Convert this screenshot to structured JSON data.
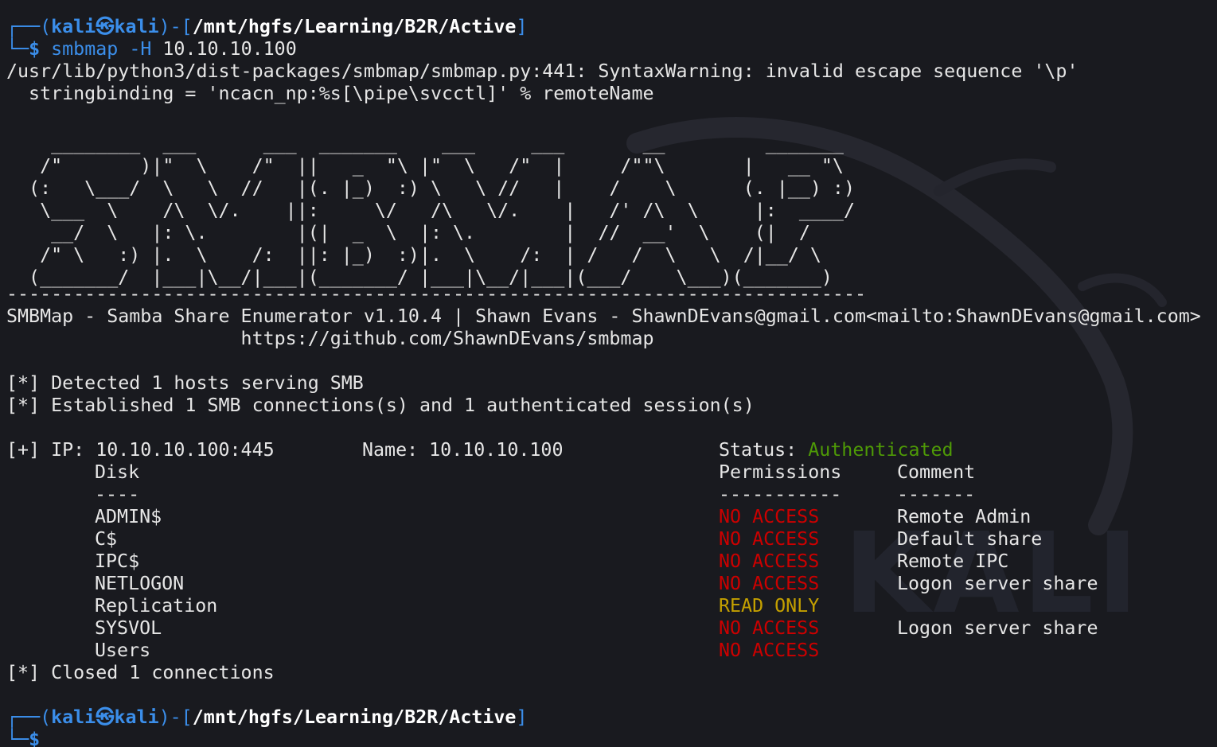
{
  "prompt": {
    "user": "kali",
    "host": "kali",
    "at_symbol": "㉿",
    "path": "/mnt/hgfs/Learning/B2R/Active",
    "dollar": "$"
  },
  "command": {
    "program": "smbmap",
    "flag": "-H",
    "target": "10.10.10.100"
  },
  "warning": {
    "line1": "/usr/lib/python3/dist-packages/smbmap/smbmap.py:441: SyntaxWarning: invalid escape sequence '\\p'",
    "line2": "  stringbinding = 'ncacn_np:%s[\\pipe\\svcctl]' % remoteName"
  },
  "banner": {
    "ascii": "    ________  ___      ___  _______    ___     ___       __         _______\n   /\"       )|\"  \\    /\"  ||   _  \"\\ |\"  \\   /\"  |     /\"\"\\       |   __ \"\\\n  (:   \\___/  \\   \\  //   |(. |_)  :) \\   \\ //   |    /    \\      (. |__) :)\n   \\___  \\    /\\  \\/.    ||:     \\/   /\\   \\/.    |   /' /\\  \\     |:  ____/\n    __/  \\   |: \\.        |(|  _  \\  |: \\.        |  //  __'  \\    (|  /\n   /\" \\   :) |.  \\    /:  ||: |_)  :)|.  \\    /:  | /   /  \\   \\  /|__/ \\\n  (_______/  |___|\\__/|___|(_______/ |___|\\__/|___|(___/    \\___)(_______)",
    "separator": "-----------------------------------------------------------------------------",
    "credit_line": "SMBMap - Samba Share Enumerator v1.10.4 | Shawn Evans - ShawnDEvans@gmail.com<mailto:ShawnDEvans@gmail.com>",
    "url_line": "                     https://github.com/ShawnDEvans/smbmap"
  },
  "status_lines": {
    "detected": "[*] Detected 1 hosts serving SMB",
    "established": "[*] Established 1 SMB connections(s) and 1 authenticated session(s)",
    "closed": "[*] Closed 1 connections"
  },
  "host_result": {
    "ip_label": "[+] IP: 10.10.10.100:445",
    "name_label": "Name: 10.10.10.100",
    "status_label": "Status: ",
    "status_value": "Authenticated"
  },
  "share_table": {
    "headers": {
      "disk": "Disk",
      "permissions": "Permissions",
      "comment": "Comment"
    },
    "underlines": {
      "disk": "----",
      "permissions": "-----------",
      "comment": "-------"
    },
    "rows": [
      {
        "disk": "ADMIN$",
        "permissions": "NO ACCESS",
        "comment": "Remote Admin",
        "perm_color": "#cc0000"
      },
      {
        "disk": "C$",
        "permissions": "NO ACCESS",
        "comment": "Default share",
        "perm_color": "#cc0000"
      },
      {
        "disk": "IPC$",
        "permissions": "NO ACCESS",
        "comment": "Remote IPC",
        "perm_color": "#cc0000"
      },
      {
        "disk": "NETLOGON",
        "permissions": "NO ACCESS",
        "comment": "Logon server share",
        "perm_color": "#cc0000"
      },
      {
        "disk": "Replication",
        "permissions": "READ ONLY",
        "comment": "",
        "perm_color": "#c4a000"
      },
      {
        "disk": "SYSVOL",
        "permissions": "NO ACCESS",
        "comment": "Logon server share",
        "perm_color": "#cc0000"
      },
      {
        "disk": "Users",
        "permissions": "NO ACCESS",
        "comment": "",
        "perm_color": "#cc0000"
      }
    ]
  },
  "wallpaper": {
    "text": "KALI"
  },
  "colors": {
    "background": "#191a1f",
    "prompt_blue": "#3b8eea",
    "status_green": "#4e9a06",
    "no_access_red": "#cc0000",
    "read_only_yellow": "#c4a000"
  }
}
